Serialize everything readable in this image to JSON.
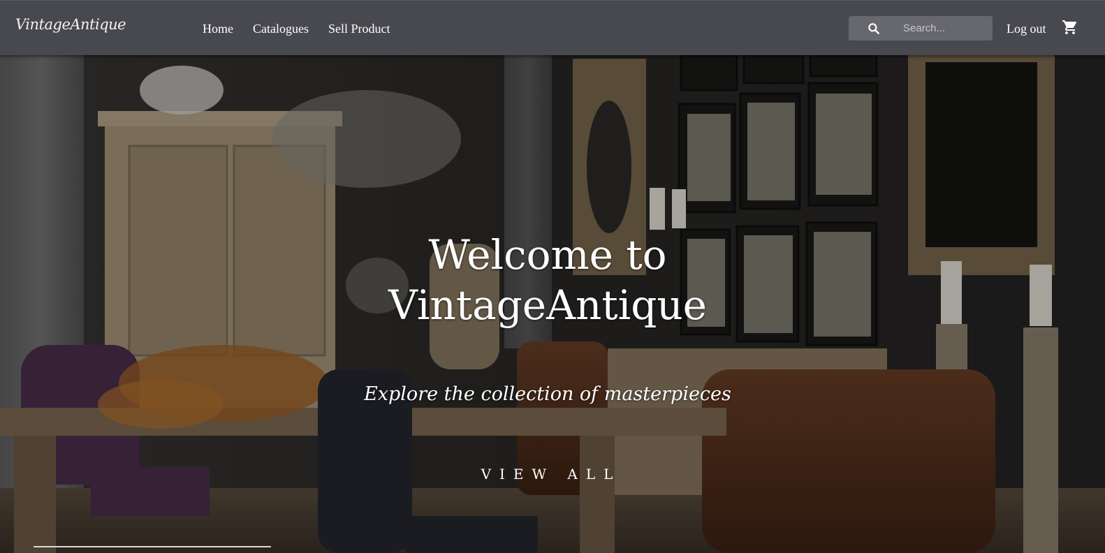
{
  "brand": {
    "logo_text": "VintageAntique"
  },
  "nav": {
    "links": [
      {
        "label": "Home"
      },
      {
        "label": "Catalogues"
      },
      {
        "label": "Sell Product"
      }
    ],
    "search": {
      "placeholder": "Search...",
      "icon": "search-icon"
    },
    "logout_label": "Log out",
    "cart_icon": "shopping-cart-icon"
  },
  "hero": {
    "title_line1": "Welcome to",
    "title_line2": "VintageAntique",
    "subtitle": "Explore the collection of masterpieces",
    "cta_label": "VIEW ALL"
  },
  "colors": {
    "navbar": "#48484f",
    "search_box": "#67676e",
    "text": "#ffffff"
  }
}
